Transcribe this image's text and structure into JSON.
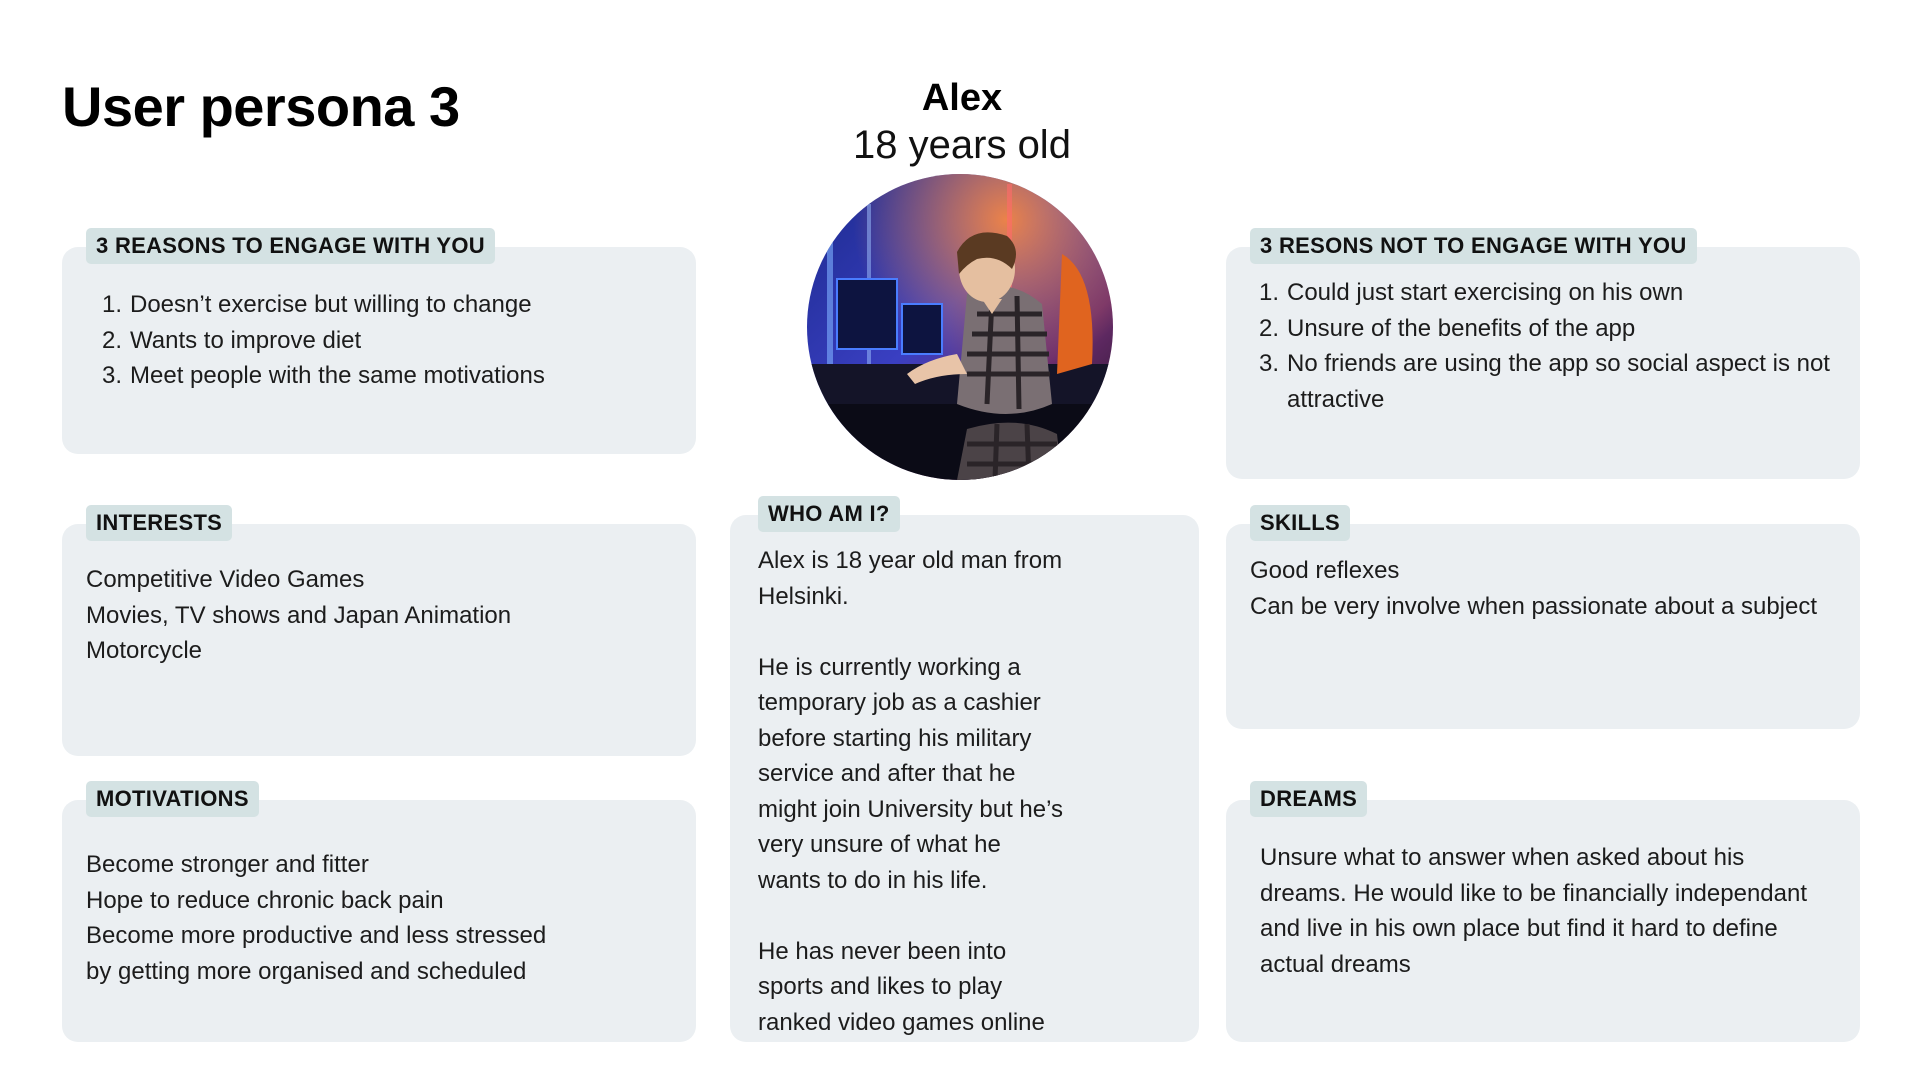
{
  "title": "User persona 3",
  "persona": {
    "name": "Alex",
    "age": "18 years old"
  },
  "avatar": {
    "description_icon": "gamer-photo"
  },
  "reasons_engage": {
    "heading": "3 REASONS TO ENGAGE WITH YOU",
    "items": [
      {
        "num": "1.",
        "text": "Doesn’t exercise but willing to change"
      },
      {
        "num": "2.",
        "text": "Wants to improve diet"
      },
      {
        "num": "3.",
        "text": "Meet people with the same motivations"
      }
    ]
  },
  "reasons_not_engage": {
    "heading": "3 RESONS NOT TO ENGAGE WITH YOU",
    "items": [
      {
        "num": "1.",
        "text": "Could just start exercising on his own"
      },
      {
        "num": "2.",
        "text": "Unsure of the benefits of the app"
      },
      {
        "num": "3.",
        "text": "No friends are using the app so social aspect is not attractive"
      }
    ]
  },
  "interests": {
    "heading": "INTERESTS",
    "items": [
      "Competitive Video Games",
      "Movies, TV shows and Japan Animation",
      "Motorcycle"
    ]
  },
  "motivations": {
    "heading": "MOTIVATIONS",
    "items": [
      "Become stronger and fitter",
      "Hope to reduce chronic back pain",
      "Become more productive and less stressed by getting more organised and scheduled"
    ]
  },
  "who_am_i": {
    "heading": "WHO AM I?",
    "paragraphs": [
      "Alex is 18 year old man from Helsinki.",
      "He is currently working a temporary job as a cashier before starting his military service and after that he might join University but he’s very unsure of what he wants to do in his life.",
      "He has never been into sports and likes to play ranked video games online"
    ]
  },
  "skills": {
    "heading": "SKILLS",
    "items": [
      "Good reflexes",
      "Can be very involve when passionate about a subject"
    ]
  },
  "dreams": {
    "heading": "DREAMS",
    "text": "Unsure what to answer when asked about his dreams. He would like to be financially independant and live in his own place but find it hard to define actual dreams"
  }
}
